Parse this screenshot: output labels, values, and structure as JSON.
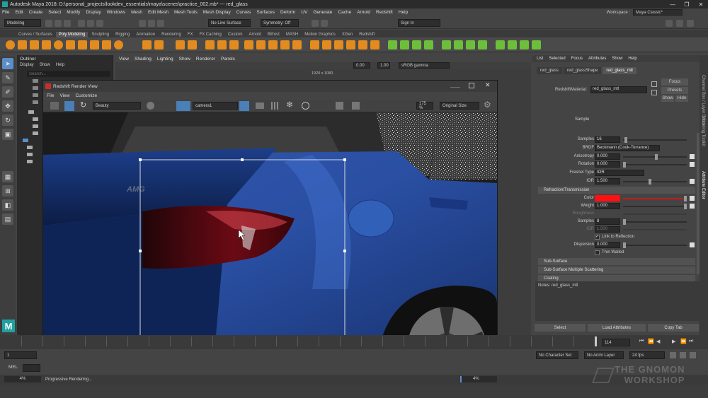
{
  "titlebar": {
    "title": "Autodesk Maya 2018: D:\\personal_projects\\lookdev_essentials\\maya\\scenes\\practice_002.mb*  ---  red_glass",
    "minimize": "—",
    "maximize": "❐",
    "close": "✕"
  },
  "menubar": {
    "items": [
      "File",
      "Edit",
      "Create",
      "Select",
      "Modify",
      "Display",
      "Windows",
      "Mesh",
      "Edit Mesh",
      "Mesh Tools",
      "Mesh Display",
      "Curves",
      "Surfaces",
      "Deform",
      "UV",
      "Generate",
      "Cache",
      "Arnold",
      "Redshift",
      "Help"
    ],
    "workspace_label": "Workspace :",
    "workspace_value": "Maya Classic*"
  },
  "statusline": {
    "mode": "Modeling",
    "live_surface": "No Live Surface",
    "symmetry": "Symmetry: Off",
    "sign_in": "Sign In"
  },
  "shelf_tabs": [
    "Curves / Surfaces",
    "Poly Modeling",
    "Sculpting",
    "Rigging",
    "Animation",
    "Rendering",
    "FX",
    "FX Caching",
    "Custom",
    "Arnold",
    "Bifrost",
    "MASH",
    "Motion Graphics",
    "XGen",
    "Redshift"
  ],
  "shelf_active": "Poly Modeling",
  "outliner": {
    "title": "Outliner",
    "menu": [
      "Display",
      "Show",
      "Help"
    ],
    "search_placeholder": "Search..."
  },
  "viewport": {
    "menu": [
      "View",
      "Shading",
      "Lighting",
      "Show",
      "Renderer",
      "Panels"
    ],
    "resolution": "1920 x 1080",
    "field1": "0.00",
    "field2": "1.00",
    "colorspace": "sRGB gamma"
  },
  "render_view": {
    "title": "Redshift Render View",
    "menu": [
      "File",
      "View",
      "Customize"
    ],
    "aov": "Beauty",
    "camera": "camera1",
    "zoom": "175 %",
    "size_mode": "Original Size",
    "car_badge": "AMG"
  },
  "attribute_editor": {
    "menu": [
      "List",
      "Selected",
      "Focus",
      "Attributes",
      "Show",
      "Help"
    ],
    "node_tabs": [
      "red_glass",
      "red_glassShape",
      "red_glass_mtl"
    ],
    "active_tab": "red_glass_mtl",
    "material_label": "RedshiftMaterial:",
    "material_value": "red_glass_mtl",
    "focus_btn": "Focus",
    "presets_btn": "Presets",
    "show_btn": "Show",
    "hide_btn": "Hide",
    "sample_label": "Sample",
    "attrs": {
      "samples_label": "Samples",
      "samples_value": "16",
      "brdf_label": "BRDF",
      "brdf_value": "Beckmann (Cook-Torrance)",
      "anisotropy_label": "Anisotropy",
      "anisotropy_value": "0.000",
      "rotation_label": "Rotation",
      "rotation_value": "0.000",
      "fresnel_label": "Fresnel Type",
      "fresnel_value": "IOR",
      "ior_label": "IOR",
      "ior_value": "1.500",
      "refraction_section": "Refraction/Transmission",
      "color_label": "Color",
      "weight_label": "Weight",
      "weight_value": "1.000",
      "roughness_label": "Roughness",
      "rsamples_label": "Samples",
      "rsamples_value": "8",
      "rior_label": "IOR",
      "rior_value": "1.500",
      "link_label": "Link to Reflection",
      "dispersion_label": "Dispersion",
      "dispersion_value": "0.000",
      "thin_label": "Thin Walled",
      "subsurface_section": "Sub-Surface",
      "sss_section": "Sub-Surface Multiple Scattering",
      "coating_section": "Coating"
    },
    "notes": "Notes:  red_glass_mtl",
    "select_btn": "Select",
    "load_btn": "Load Attributes",
    "copy_btn": "Copy Tab",
    "side_tabs": [
      "Channel Box / Layer Editor",
      "Modeling Toolkit",
      "Attribute Editor"
    ]
  },
  "timeline": {
    "current_frame": "114",
    "start": "1",
    "range_start": "1",
    "character_set": "No Character Set",
    "anim_layer": "No Anim Layer",
    "fps": "24 fps"
  },
  "cmdline": {
    "label": "MEL"
  },
  "helpline": {
    "text": "Progressive Rendering..."
  },
  "progress": {
    "left_pct": "4%",
    "right_pct": "4%"
  },
  "watermark": {
    "line1": "THE GNOMON",
    "line2": "WORKSHOP"
  },
  "colors": {
    "accent_blue": "#5a8ec9",
    "refraction_red": "#ff1010",
    "maya_teal": "#21a0a0",
    "shelf_orange": "#e38b1e",
    "shelf_green": "#6cbf3a"
  }
}
